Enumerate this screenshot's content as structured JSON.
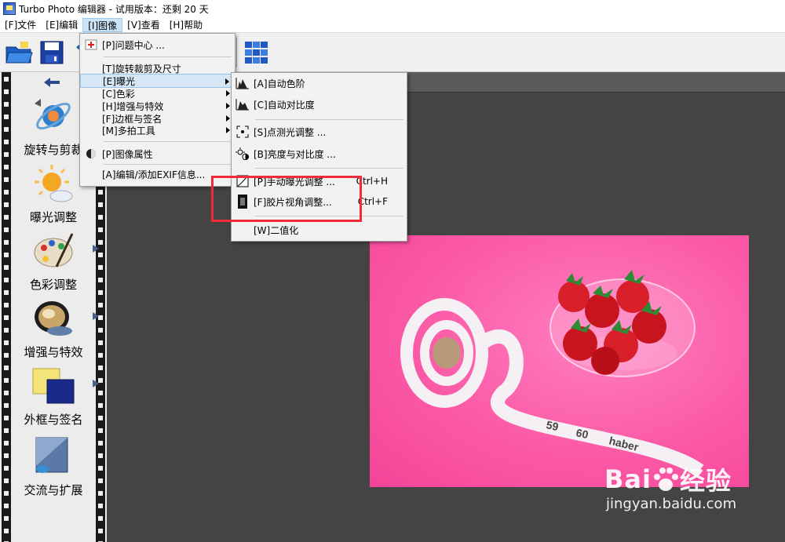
{
  "window": {
    "title": "Turbo Photo 编辑器 - 试用版本：还剩 20 天"
  },
  "menubar": {
    "items": [
      {
        "label": "[F]文件"
      },
      {
        "label": "[E]编辑"
      },
      {
        "label": "[I]图像",
        "active": true
      },
      {
        "label": "[V]查看"
      },
      {
        "label": "[H]帮助"
      }
    ]
  },
  "toolbar": {
    "icons": [
      "open-folder-icon",
      "save-icon",
      "undo-icon",
      "redo-icon",
      "print-icon",
      "paint-brush-icon",
      "eraser-icon",
      "grid-thumbnails-icon"
    ]
  },
  "sidebar": {
    "back_arrow": "back-arrow-icon",
    "items": [
      {
        "label": "旋转与剪裁",
        "icon": "rotate-crop-icon"
      },
      {
        "label": "曝光调整",
        "icon": "sun-exposure-icon"
      },
      {
        "label": "色彩调整",
        "icon": "palette-icon"
      },
      {
        "label": "增强与特效",
        "icon": "lens-filter-icon"
      },
      {
        "label": "外框与签名",
        "icon": "frame-icon"
      },
      {
        "label": "交流与扩展",
        "icon": "share-icon"
      }
    ]
  },
  "image_menu": {
    "items": [
      {
        "label": "[P]问题中心 ...",
        "icon": "help-center-icon"
      },
      {
        "label": "[T]旋转裁剪及尺寸"
      },
      {
        "label": "[E]曝光",
        "highlighted": true,
        "submenu": true
      },
      {
        "label": "[C]色彩",
        "submenu": true
      },
      {
        "label": "[H]增强与特效",
        "submenu": true
      },
      {
        "label": "[F]边框与签名",
        "submenu": true
      },
      {
        "label": "[M]多拍工具",
        "submenu": true
      },
      {
        "label": "[P]图像属性",
        "icon": "image-properties-icon"
      },
      {
        "label": "[A]编辑/添加EXIF信息..."
      }
    ]
  },
  "exposure_menu": {
    "items": [
      {
        "label": "[A]自动色阶",
        "icon": "histogram-icon"
      },
      {
        "label": "[C]自动对比度",
        "icon": "histogram-icon"
      },
      {
        "label": "[S]点测光调整 ...",
        "icon": "spot-metering-icon"
      },
      {
        "label": "[B]亮度与对比度 ...",
        "icon": "brightness-contrast-icon"
      },
      {
        "label": "[P]手动曝光调整 ...",
        "shortcut": "Ctrl+H",
        "icon": "curve-icon"
      },
      {
        "label": "[F]胶片视角调整...",
        "shortcut": "Ctrl+F",
        "icon": "film-icon"
      },
      {
        "label": "[W]二值化"
      }
    ]
  },
  "photo": {
    "tape_numbers": [
      "59",
      "60",
      "haber"
    ]
  },
  "watermark": {
    "brand": "Bai",
    "brand2": "经验",
    "url": "jingyan.baidu.com"
  }
}
